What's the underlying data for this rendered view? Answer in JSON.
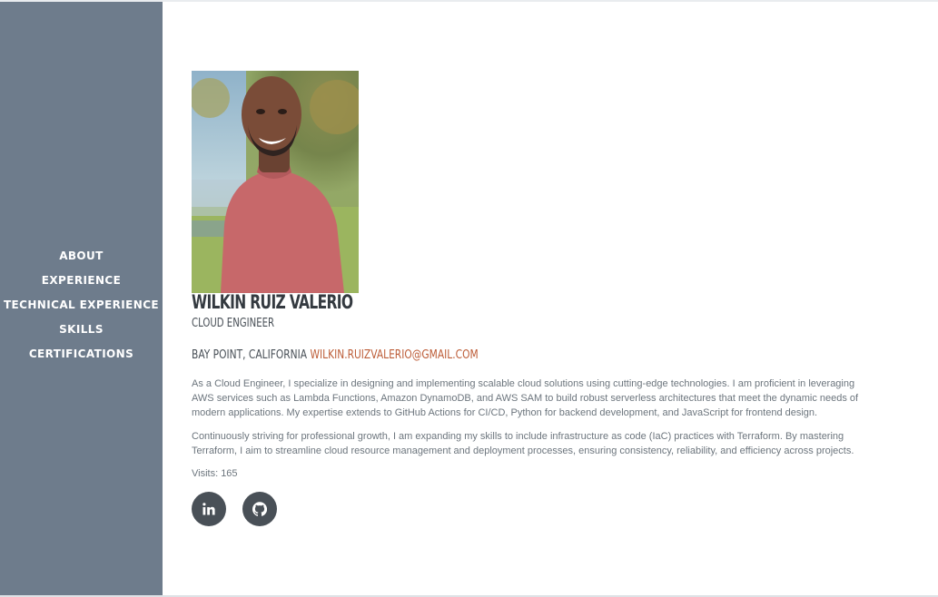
{
  "nav": {
    "items": [
      {
        "label": "ABOUT"
      },
      {
        "label": "EXPERIENCE"
      },
      {
        "label": "TECHNICAL EXPERIENCE"
      },
      {
        "label": "SKILLS"
      },
      {
        "label": "CERTIFICATIONS"
      }
    ]
  },
  "profile": {
    "name": "WILKIN RUIZ VALERIO",
    "title": "CLOUD ENGINEER",
    "location": "BAY POINT, CALIFORNIA",
    "email": "WILKIN.RUIZVALERIO@GMAIL.COM",
    "bio": [
      "As a Cloud Engineer, I specialize in designing and implementing scalable cloud solutions using cutting-edge technologies. I am proficient in leveraging AWS services such as Lambda Functions, Amazon DynamoDB, and AWS SAM to build robust serverless architectures that meet the dynamic needs of modern applications. My expertise extends to GitHub Actions for CI/CD, Python for backend development, and JavaScript for frontend design.",
      "Continuously striving for professional growth, I am expanding my skills to include infrastructure as code (IaC) practices with Terraform. By mastering Terraform, I aim to streamline cloud resource management and deployment processes, ensuring consistency, reliability, and efficiency across projects."
    ],
    "visits": "Visits: 165"
  },
  "social": [
    {
      "icon": "linkedin-icon"
    },
    {
      "icon": "github-icon"
    }
  ],
  "colors": {
    "sidebar": "#6e7c8c",
    "accent": "#bd5d38",
    "heading": "#343a40",
    "text": "#6c757d",
    "social_bg": "#495057"
  }
}
